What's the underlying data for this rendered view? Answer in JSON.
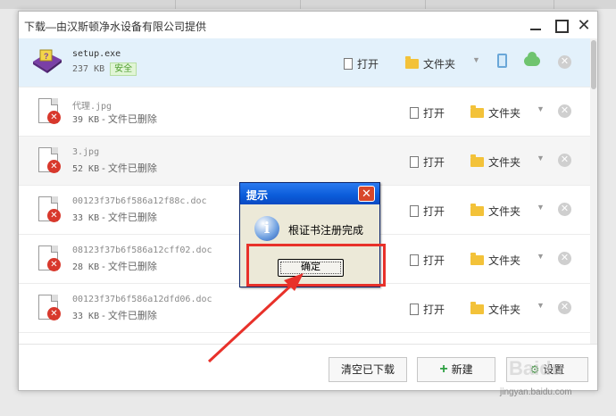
{
  "window": {
    "title": "下载—由汉斯顿净水设备有限公司提供"
  },
  "files": [
    {
      "name": "setup.exe",
      "size": "237 KB",
      "status": "安全",
      "open_label": "打开",
      "folder_label": "文件夹"
    },
    {
      "name": "代理.jpg",
      "size": "39 KB",
      "status": "- 文件已删除",
      "open_label": "打开",
      "folder_label": "文件夹"
    },
    {
      "name": "3.jpg",
      "size": "52 KB",
      "status": "- 文件已删除",
      "open_label": "打开",
      "folder_label": "文件夹"
    },
    {
      "name": "00123f37b6f586a12f88c.doc",
      "size": "33 KB",
      "status": "- 文件已删除",
      "open_label": "打开",
      "folder_label": "文件夹"
    },
    {
      "name": "08123f37b6f586a12cff02.doc",
      "size": "28 KB",
      "status": "- 文件已删除",
      "open_label": "打开",
      "folder_label": "文件夹"
    },
    {
      "name": "00123f37b6f586a12dfd06.doc",
      "size": "33 KB",
      "status": "- 文件已删除",
      "open_label": "打开",
      "folder_label": "文件夹"
    }
  ],
  "footer": {
    "clear_label": "清空已下载",
    "new_label": "新建",
    "settings_label": "设置"
  },
  "dialog": {
    "title": "提示",
    "message": "根证书注册完成",
    "ok_label": "确定"
  },
  "watermark": {
    "text": "jingyan.baidu.com",
    "logo": "Baidu"
  },
  "colors": {
    "selected_row": "#e3f1fb",
    "annotation": "#e8312a",
    "dialog_title": "#0a5bd9"
  }
}
